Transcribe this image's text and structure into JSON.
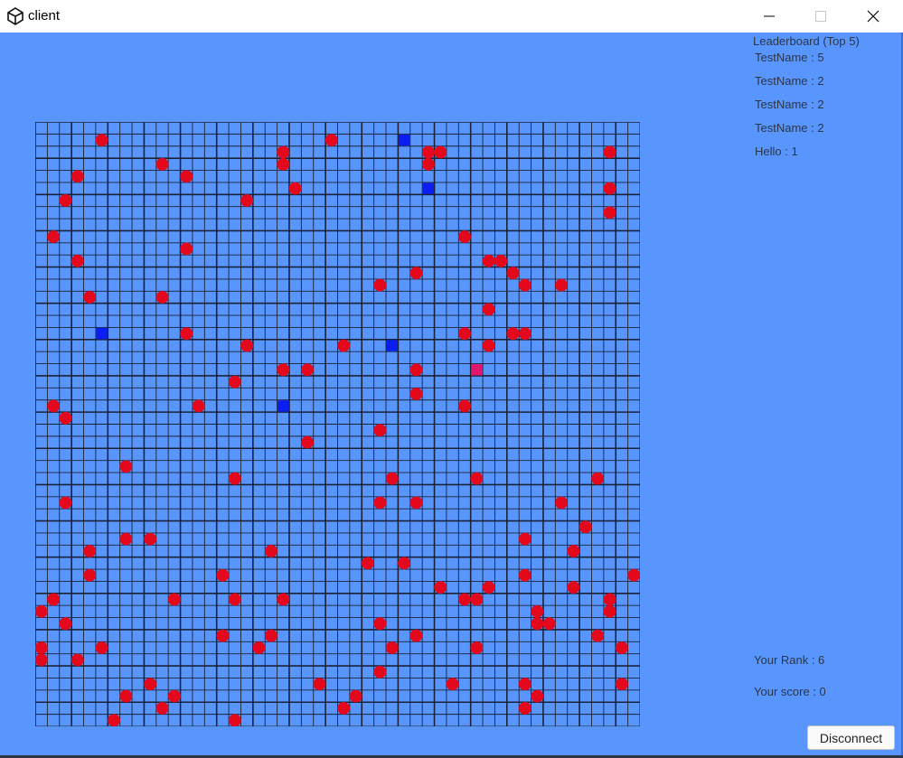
{
  "window": {
    "title": "client"
  },
  "leaderboard": {
    "title": "Leaderboard (Top 5)",
    "entries": [
      "TestName : 5",
      "TestName : 2",
      "TestName : 2",
      "TestName : 2",
      "Hello : 1"
    ]
  },
  "player": {
    "rank": "Your Rank : 6",
    "score": "Your score : 0"
  },
  "buttons": {
    "disconnect": "Disconnect"
  },
  "board": {
    "cells": 50,
    "colors": {
      "background": "#5896fd",
      "grid": "#1b2236",
      "food": "#e3081b",
      "enemy": "#0b1ef2",
      "player": "#e3166f"
    },
    "food": [
      [
        5,
        1
      ],
      [
        10,
        3
      ],
      [
        20,
        2
      ],
      [
        24,
        1
      ],
      [
        32,
        2
      ],
      [
        33,
        2
      ],
      [
        47,
        2
      ],
      [
        3,
        4
      ],
      [
        12,
        4
      ],
      [
        20,
        3
      ],
      [
        32,
        3
      ],
      [
        2,
        6
      ],
      [
        17,
        6
      ],
      [
        21,
        5
      ],
      [
        47,
        5
      ],
      [
        47,
        7
      ],
      [
        1,
        9
      ],
      [
        35,
        9
      ],
      [
        12,
        10
      ],
      [
        3,
        11
      ],
      [
        37,
        11
      ],
      [
        38,
        11
      ],
      [
        39,
        12
      ],
      [
        31,
        12
      ],
      [
        28,
        13
      ],
      [
        40,
        13
      ],
      [
        43,
        13
      ],
      [
        4,
        14
      ],
      [
        10,
        14
      ],
      [
        37,
        15
      ],
      [
        12,
        17
      ],
      [
        35,
        17
      ],
      [
        39,
        17
      ],
      [
        40,
        17
      ],
      [
        17,
        18
      ],
      [
        25,
        18
      ],
      [
        37,
        18
      ],
      [
        20,
        20
      ],
      [
        22,
        20
      ],
      [
        31,
        20
      ],
      [
        16,
        21
      ],
      [
        31,
        22
      ],
      [
        1,
        23
      ],
      [
        13,
        23
      ],
      [
        35,
        23
      ],
      [
        2,
        24
      ],
      [
        28,
        25
      ],
      [
        22,
        26
      ],
      [
        7,
        28
      ],
      [
        16,
        29
      ],
      [
        29,
        29
      ],
      [
        36,
        29
      ],
      [
        46,
        29
      ],
      [
        2,
        31
      ],
      [
        28,
        31
      ],
      [
        31,
        31
      ],
      [
        43,
        31
      ],
      [
        45,
        33
      ],
      [
        7,
        34
      ],
      [
        9,
        34
      ],
      [
        40,
        34
      ],
      [
        4,
        35
      ],
      [
        19,
        35
      ],
      [
        44,
        35
      ],
      [
        27,
        36
      ],
      [
        30,
        36
      ],
      [
        4,
        37
      ],
      [
        15,
        37
      ],
      [
        40,
        37
      ],
      [
        49,
        37
      ],
      [
        33,
        38
      ],
      [
        37,
        38
      ],
      [
        44,
        38
      ],
      [
        1,
        39
      ],
      [
        11,
        39
      ],
      [
        16,
        39
      ],
      [
        20,
        39
      ],
      [
        35,
        39
      ],
      [
        36,
        39
      ],
      [
        47,
        39
      ],
      [
        0,
        40
      ],
      [
        41,
        40
      ],
      [
        47,
        40
      ],
      [
        2,
        41
      ],
      [
        28,
        41
      ],
      [
        41,
        41
      ],
      [
        42,
        41
      ],
      [
        15,
        42
      ],
      [
        19,
        42
      ],
      [
        31,
        42
      ],
      [
        46,
        42
      ],
      [
        0,
        43
      ],
      [
        5,
        43
      ],
      [
        18,
        43
      ],
      [
        29,
        43
      ],
      [
        36,
        43
      ],
      [
        48,
        43
      ],
      [
        0,
        44
      ],
      [
        3,
        44
      ],
      [
        28,
        45
      ],
      [
        9,
        46
      ],
      [
        23,
        46
      ],
      [
        34,
        46
      ],
      [
        40,
        46
      ],
      [
        48,
        46
      ],
      [
        7,
        47
      ],
      [
        11,
        47
      ],
      [
        26,
        47
      ],
      [
        41,
        47
      ],
      [
        10,
        48
      ],
      [
        25,
        48
      ],
      [
        40,
        48
      ],
      [
        6,
        49
      ],
      [
        16,
        49
      ]
    ],
    "enemies": [
      [
        30,
        1
      ],
      [
        32,
        5
      ],
      [
        5,
        17
      ],
      [
        29,
        18
      ],
      [
        20,
        23
      ]
    ],
    "player": [
      36,
      20
    ]
  }
}
